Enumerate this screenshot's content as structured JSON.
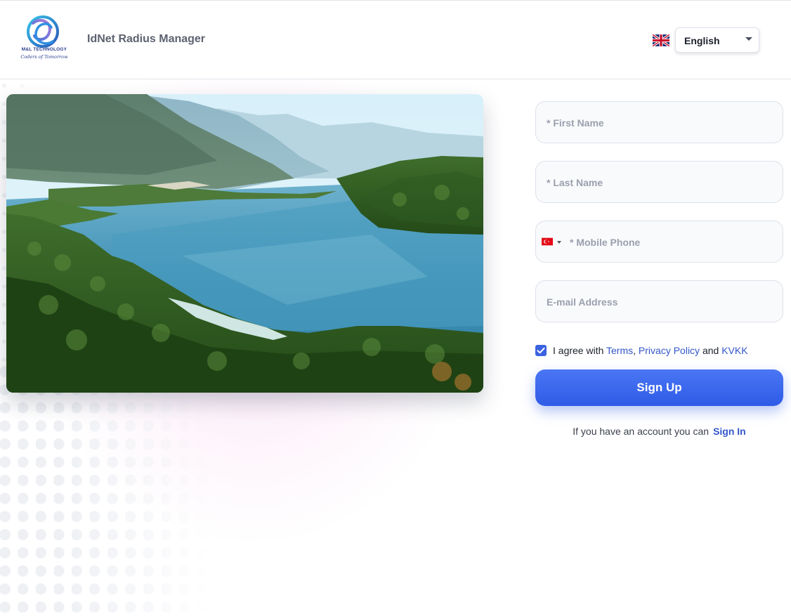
{
  "header": {
    "logo_company": "M&L TECHNOLOGY",
    "logo_slogan": "Coders of Tomorrow",
    "app_title": "IdNet Radius Manager",
    "language_flag_icon": "uk-flag-icon",
    "language_value": "English"
  },
  "hero": {
    "image_subject": "turquoise lagoon among forested mountains"
  },
  "form": {
    "first_name_placeholder": "* First Name",
    "last_name_placeholder": "* Last Name",
    "phone_country_icon": "turkey-flag-icon",
    "mobile_phone_placeholder": "* Mobile Phone",
    "email_placeholder": "E-mail Address",
    "agree_checked": true,
    "agree_prefix": "I agree with",
    "terms_link": "Terms",
    "comma": ",",
    "privacy_link": "Privacy Policy",
    "and_text": "and",
    "kvkk_link": "KVKK",
    "signup_button": "Sign Up",
    "signin_prompt": "If you have an account you can",
    "signin_link": "Sign In"
  },
  "colors": {
    "primary": "#3b63e0",
    "link": "#3357c9",
    "placeholder": "#9aa0ad",
    "pink_glow": "#f7ccec"
  }
}
